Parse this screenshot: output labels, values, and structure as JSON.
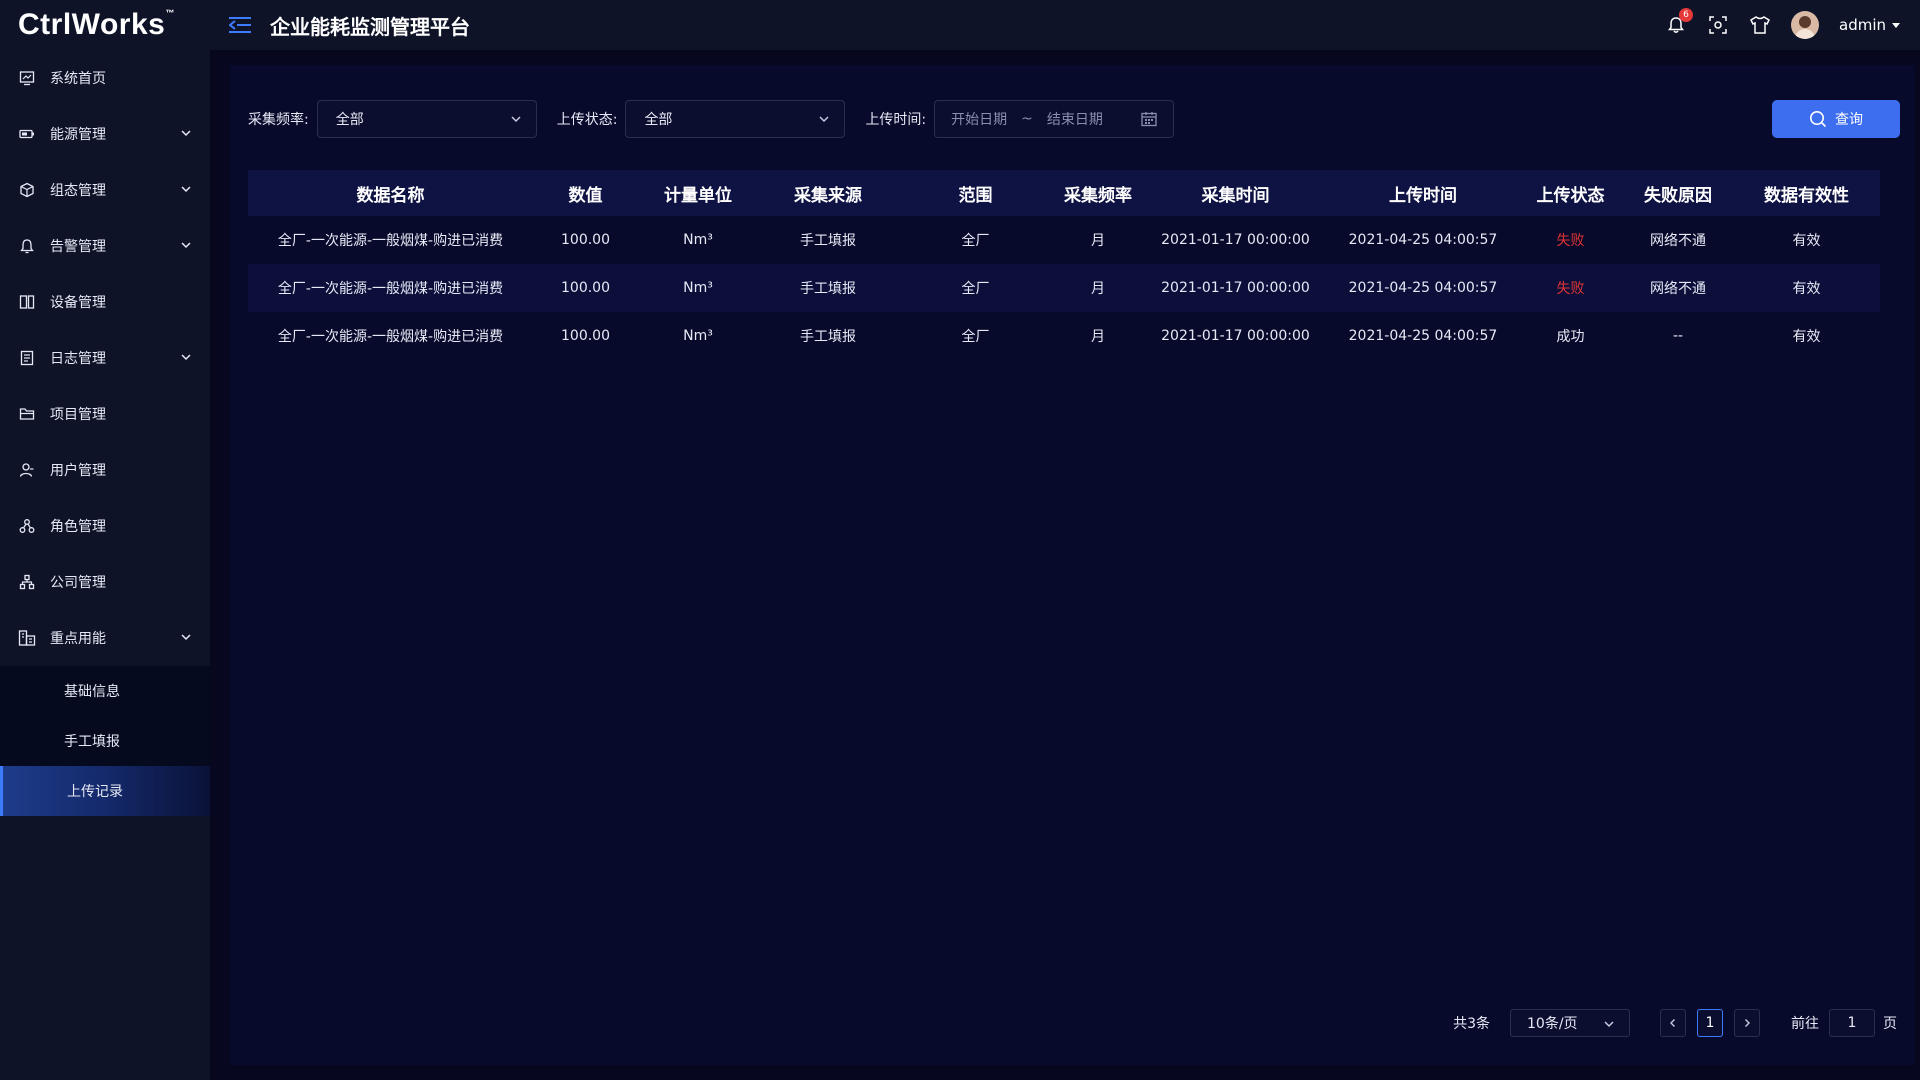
{
  "app": {
    "logo": "CtrlWorks",
    "logo_mark": "™",
    "title": "企业能耗监测管理平台"
  },
  "header": {
    "notification_count": "6",
    "user_name": "admin"
  },
  "sidebar": {
    "items": [
      {
        "label": "系统首页",
        "icon": "monitor-icon",
        "has_children": false
      },
      {
        "label": "能源管理",
        "icon": "battery-icon",
        "has_children": true
      },
      {
        "label": "组态管理",
        "icon": "cube-icon",
        "has_children": true
      },
      {
        "label": "告警管理",
        "icon": "bell-icon",
        "has_children": true
      },
      {
        "label": "设备管理",
        "icon": "device-icon",
        "has_children": false
      },
      {
        "label": "日志管理",
        "icon": "document-icon",
        "has_children": true
      },
      {
        "label": "项目管理",
        "icon": "folder-icon",
        "has_children": false
      },
      {
        "label": "用户管理",
        "icon": "user-icon",
        "has_children": false
      },
      {
        "label": "角色管理",
        "icon": "role-icon",
        "has_children": false
      },
      {
        "label": "公司管理",
        "icon": "org-icon",
        "has_children": false
      },
      {
        "label": "重点用能",
        "icon": "building-icon",
        "has_children": true
      }
    ],
    "subitems": [
      {
        "label": "基础信息",
        "active": false
      },
      {
        "label": "手工填报",
        "active": false
      },
      {
        "label": "上传记录",
        "active": true
      }
    ]
  },
  "filters": {
    "frequency_label": "采集频率:",
    "frequency_value": "全部",
    "status_label": "上传状态:",
    "status_value": "全部",
    "time_label": "上传时间:",
    "start_placeholder": "开始日期",
    "separator": "~",
    "end_placeholder": "结束日期",
    "query_label": "查询"
  },
  "table": {
    "columns": [
      "数据名称",
      "数值",
      "计量单位",
      "采集来源",
      "范围",
      "采集频率",
      "采集时间",
      "上传时间",
      "上传状态",
      "失败原因",
      "数据有效性"
    ],
    "rows": [
      [
        "全厂-一次能源-一般烟煤-购进已消费",
        "100.00",
        "Nm³",
        "手工填报",
        "全厂",
        "月",
        "2021-01-17 00:00:00",
        "2021-04-25 04:00:57",
        "失败",
        "网络不通",
        "有效"
      ],
      [
        "全厂-一次能源-一般烟煤-购进已消费",
        "100.00",
        "Nm³",
        "手工填报",
        "全厂",
        "月",
        "2021-01-17 00:00:00",
        "2021-04-25 04:00:57",
        "失败",
        "网络不通",
        "有效"
      ],
      [
        "全厂-一次能源-一般烟煤-购进已消费",
        "100.00",
        "Nm³",
        "手工填报",
        "全厂",
        "月",
        "2021-01-17 00:00:00",
        "2021-04-25 04:00:57",
        "成功",
        "--",
        "有效"
      ]
    ]
  },
  "pagination": {
    "total": "共3条",
    "page_size": "10条/页",
    "current_page": "1",
    "goto_label": "前往",
    "goto_value": "1",
    "page_suffix": "页"
  },
  "colors": {
    "accent": "#3e6ef0",
    "fail": "#e03434",
    "sidebar_bg": "#0e1328",
    "content_bg": "#080a2b"
  }
}
